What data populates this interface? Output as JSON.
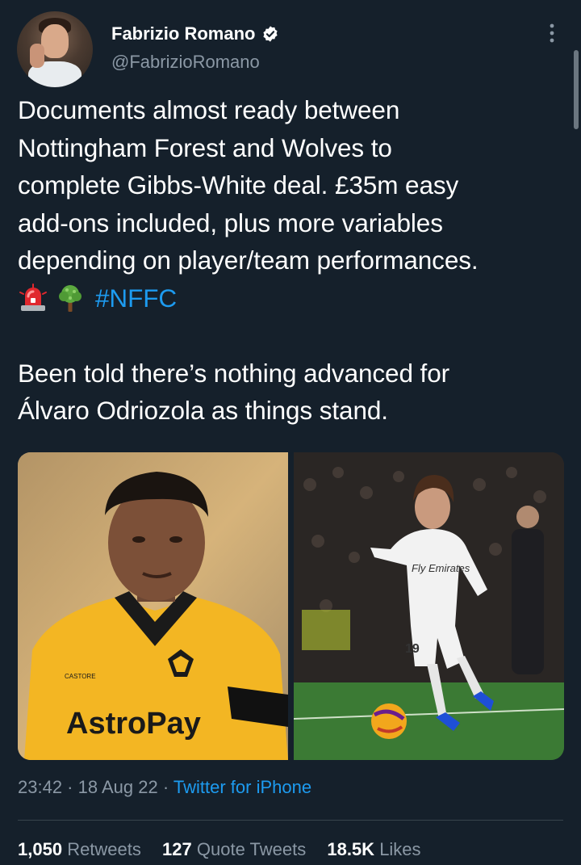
{
  "author": {
    "display_name": "Fabrizio Romano",
    "handle": "@FabrizioRomano",
    "verified_icon": "verified-badge-icon",
    "avatar": "profile-photo"
  },
  "tweet": {
    "paragraph1_lines": [
      "Documents almost ready between",
      "Nottingham Forest and Wolves to",
      "complete Gibbs-White deal. £35m easy",
      "add-ons included, plus more variables",
      "depending on player/team performances."
    ],
    "emojis": [
      "rotating-light-emoji",
      "deciduous-tree-emoji"
    ],
    "hashtag": "#NFFC",
    "paragraph2_lines": [
      "Been told there’s nothing advanced for",
      "Álvaro Odriozola as things stand."
    ]
  },
  "media": {
    "left_photo": {
      "shirt_text": "AstroPay",
      "badge_text": "CASTORE"
    },
    "right_photo": {
      "shirt_text": "Fly Emirates",
      "number": "19"
    }
  },
  "meta": {
    "time": "23:42",
    "separator": " · ",
    "date": "18 Aug 22",
    "source": "Twitter for iPhone"
  },
  "stats": {
    "retweets_count": "1,050",
    "retweets_label": "Retweets",
    "quotes_count": "127",
    "quotes_label": "Quote Tweets",
    "likes_count": "18.5K",
    "likes_label": "Likes"
  },
  "colors": {
    "background": "#15202b",
    "text": "#ffffff",
    "secondary_text": "#8b98a5",
    "link": "#1d9bf0",
    "divider": "#38444d"
  }
}
